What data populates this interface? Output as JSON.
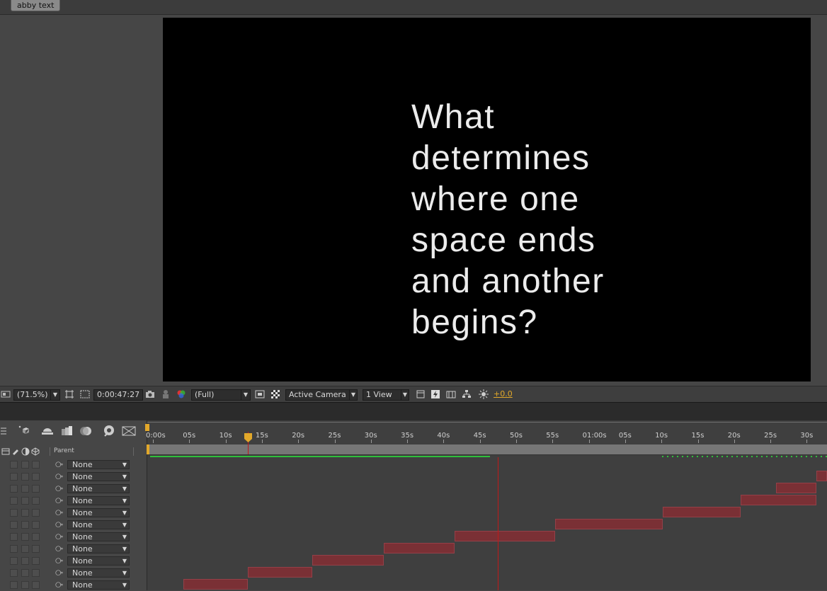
{
  "composition_tab": "abby text",
  "canvas": {
    "lines": [
      "What",
      "determines",
      "where one",
      "space ends",
      "and another",
      "begins?"
    ],
    "background": "#000000",
    "text_color": "#ececec"
  },
  "viewer_toolbar": {
    "magnification": "(71.5%)",
    "timecode": "0:00:47:27",
    "resolution": "(Full)",
    "camera": "Active Camera",
    "views": "1 View",
    "exposure": "+0.0",
    "icons": [
      "composition-icon",
      "region-icon",
      "transparency-grid-icon",
      "snapshot-icon",
      "show-snapshot-icon",
      "channel-icon",
      "fast-preview-icon",
      "timeline-icon",
      "flowchart-icon",
      "exposure-icon"
    ]
  },
  "timeline": {
    "column_header": "Parent",
    "ruler_labels": [
      "0:00s",
      "05s",
      "10s",
      "15s",
      "20s",
      "25s",
      "30s",
      "35s",
      "40s",
      "45s",
      "50s",
      "55s",
      "01:00s",
      "05s",
      "10s",
      "15s",
      "20s",
      "25s",
      "30s"
    ],
    "current_time_seconds": 47.9,
    "layer_parent_values": [
      "None",
      "None",
      "None",
      "None",
      "None",
      "None",
      "None",
      "None",
      "None",
      "None",
      "None"
    ],
    "layer_color": "#7a3035",
    "green_bar_color": "#2fbf3b",
    "cti_color": "#c01a1a",
    "tool_icons": [
      "search-layers-icon",
      "composition-mini-flowchart-icon",
      "shy-icon",
      "frame-blending-icon",
      "motion-blur-icon",
      "graph-editor-icon",
      "draft-3d-icon"
    ]
  }
}
